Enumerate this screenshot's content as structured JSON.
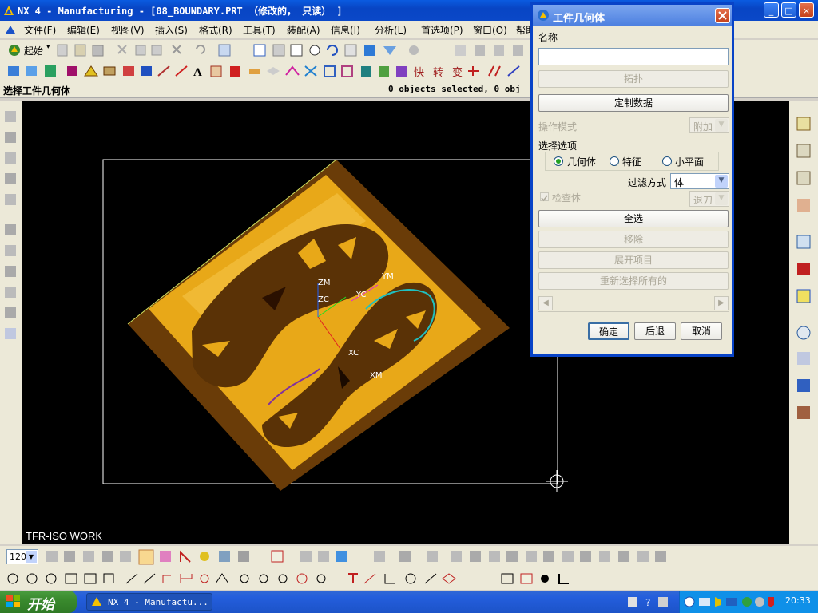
{
  "window": {
    "title": "NX 4 - Manufacturing - [08_BOUNDARY.PRT （修改的， 只读） ]",
    "buttons": {
      "minimize": "_",
      "maximize": "□",
      "close": "×"
    }
  },
  "menu": [
    "文件(F)",
    "编辑(E)",
    "视图(V)",
    "插入(S)",
    "格式(R)",
    "工具(T)",
    "装配(A)",
    "信息(I)",
    "分析(L)",
    "首选项(P)",
    "窗口(O)",
    "帮助"
  ],
  "toolbar": {
    "start_label": "起始"
  },
  "cue_line": {
    "prompt": "选择工件几何体",
    "status": "0 objects selected, 0 obj"
  },
  "graphics": {
    "view_label": "TFR-ISO WORK",
    "axis_labels": {
      "zm": "ZM",
      "ym": "YM",
      "zc": "ZC",
      "yc": "YC",
      "xc": "XC",
      "xm": "XM"
    }
  },
  "bottom_toolbar": {
    "scale_value": "120"
  },
  "dialog": {
    "title": "工件几何体",
    "name_label": "名称",
    "name_value": "",
    "topology_button": "拓扑",
    "custom_data_button": "定制数据",
    "operation_mode_label": "操作模式",
    "operation_mode_value": "附加",
    "selection_options_label": "选择选项",
    "radio_options": [
      {
        "label": "几何体",
        "selected": true
      },
      {
        "label": "特征",
        "selected": false
      },
      {
        "label": "小平面",
        "selected": false
      }
    ],
    "filter_label": "过滤方式",
    "filter_value": "体",
    "check_body_label": "检查体",
    "back_value": "退刀",
    "select_all_button": "全选",
    "remove_button": "移除",
    "expand_button": "展开项目",
    "reselect_button": "重新选择所有的",
    "ok_button": "确定",
    "back_button": "后退",
    "cancel_button": "取消"
  },
  "taskbar": {
    "start_label": "开始",
    "task_item": "NX 4 - Manufactu...",
    "clock": "20:33"
  },
  "colors": {
    "part_gold": "#e8a818",
    "part_brown": "#5a3206",
    "title_blue": "#0a5be0"
  }
}
